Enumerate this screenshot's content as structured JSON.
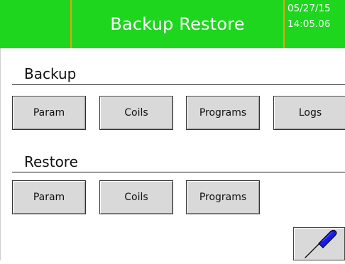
{
  "header": {
    "title": "Backup Restore",
    "date": "05/27/15",
    "time": "14:05.06",
    "bg_color": "#1ed61e",
    "divider_color": "#e3a414"
  },
  "backup": {
    "label": "Backup",
    "buttons": [
      "Param",
      "Coils",
      "Programs",
      "Logs"
    ]
  },
  "restore": {
    "label": "Restore",
    "buttons": [
      "Param",
      "Coils",
      "Programs"
    ]
  },
  "tool": {
    "icon": "screwdriver-icon",
    "color": "#1a1ae6"
  }
}
